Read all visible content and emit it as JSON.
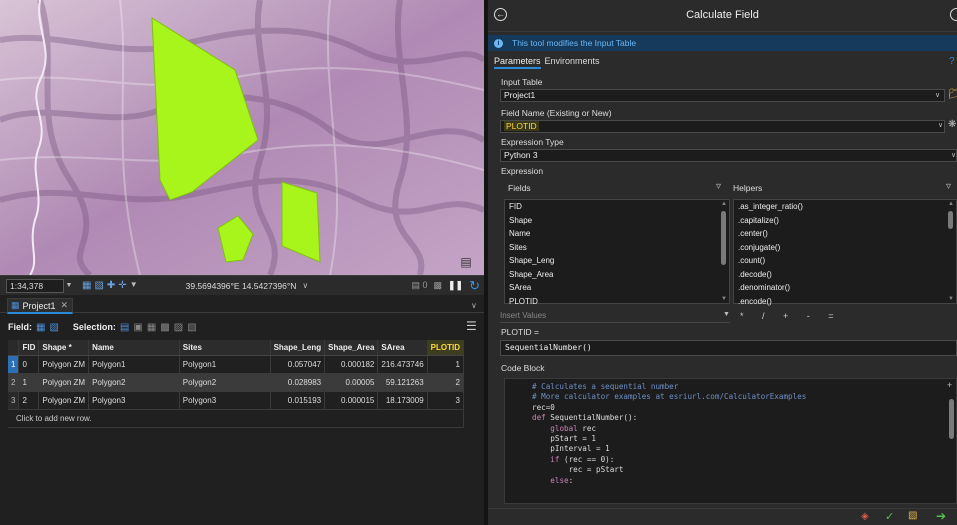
{
  "map": {
    "scale": "1:34,378",
    "coordinates": "39.5694396°E 14.5427396°N",
    "colors": {
      "terrain": "#b28fb6",
      "polygon": "#a8f51b"
    }
  },
  "status_icons": [
    "pause-icon",
    "refresh-icon"
  ],
  "table_pane": {
    "tab_label": "Project1",
    "toolbar": {
      "field_label": "Field:",
      "selection_label": "Selection:"
    },
    "columns": [
      "",
      "FID",
      "Shape *",
      "Name",
      "Sites",
      "Shape_Leng",
      "Shape_Area",
      "SArea",
      "PLOTID"
    ],
    "rows": [
      [
        "1",
        "0",
        "Polygon ZM",
        "Polygon1",
        "Polygon1",
        "0.057047",
        "0.000182",
        "216.473746",
        "1"
      ],
      [
        "2",
        "1",
        "Polygon ZM",
        "Polygon2",
        "Polygon2",
        "0.028983",
        "0.00005",
        "59.121263",
        "2"
      ],
      [
        "3",
        "2",
        "Polygon ZM",
        "Polygon3",
        "Polygon3",
        "0.015193",
        "0.000015",
        "18.173009",
        "3"
      ]
    ],
    "add_row_text": "Click to add new row."
  },
  "tool": {
    "title": "Calculate Field",
    "info_message": "This tool modifies the Input Table",
    "tabs": {
      "parameters": "Parameters",
      "environments": "Environments"
    },
    "input_table": {
      "label": "Input Table",
      "value": "Project1"
    },
    "field_name": {
      "label": "Field Name (Existing or New)",
      "value": "PLOTID"
    },
    "expression_type": {
      "label": "Expression Type",
      "value": "Python 3"
    },
    "expression_label": "Expression",
    "fields_label": "Fields",
    "helpers_label": "Helpers",
    "fields": [
      "FID",
      "Shape",
      "Name",
      "Sites",
      "Shape_Leng",
      "Shape_Area",
      "SArea",
      "PLOTID"
    ],
    "helpers": [
      ".as_integer_ratio()",
      ".capitalize()",
      ".center()",
      ".conjugate()",
      ".count()",
      ".decode()",
      ".denominator()",
      ".encode()"
    ],
    "insert_values_placeholder": "Insert Values",
    "operators": "* / + - =",
    "expression_target_label": "PLOTID =",
    "expression_value": "SequentialNumber()",
    "code_block_label": "Code Block",
    "code_lines": [
      "# Calculates a sequential number",
      "# More calculator examples at esriurl.com/CalculatorExamples",
      "rec=0",
      "def SequentialNumber():",
      "    global rec",
      "    pStart = 1",
      "    pInterval = 1",
      "    if (rec == 0):",
      "        rec = pStart",
      "    else:"
    ]
  }
}
